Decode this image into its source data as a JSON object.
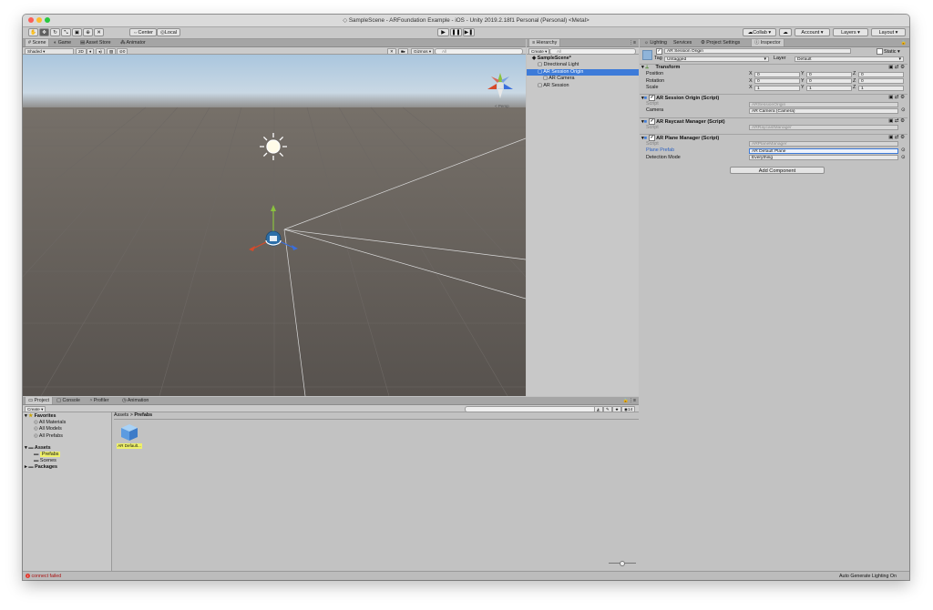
{
  "window": {
    "title": "SampleScene - ARFoundation Example - iOS - Unity 2019.2.18f1 Personal (Personal) <Metal>"
  },
  "toolbar": {
    "pivot_label": "Center",
    "space_label": "Local",
    "collab_label": "Collab",
    "account_label": "Account",
    "layers_label": "Layers",
    "layout_label": "Layout",
    "play_glyph": "▶",
    "pause_glyph": "❚❚",
    "step_glyph": "▶❚"
  },
  "scene_tabs": [
    "Scene",
    "Game",
    "Asset Store",
    "Animator"
  ],
  "scene_toolbar": {
    "shading": "Shaded",
    "mode_2d": "2D",
    "gizmos": "Gizmos",
    "search_placeholder": "All",
    "fx_count": "0"
  },
  "hierarchy": {
    "tab": "Hierarchy",
    "create": "Create",
    "search_placeholder": "All",
    "items": [
      {
        "label": "SampleScene*",
        "depth": 0,
        "selected": false,
        "bold": true
      },
      {
        "label": "Directional Light",
        "depth": 1,
        "selected": false,
        "bold": false
      },
      {
        "label": "AR Session Origin",
        "depth": 1,
        "selected": true,
        "bold": false
      },
      {
        "label": "AR Camera",
        "depth": 2,
        "selected": false,
        "bold": false
      },
      {
        "label": "AR Session",
        "depth": 1,
        "selected": false,
        "bold": false
      }
    ]
  },
  "inspector_tabs": [
    "Lighting",
    "Services",
    "Project Settings",
    "Inspector"
  ],
  "inspector": {
    "object_name": "AR Session Origin",
    "static_label": "Static",
    "tag_label": "Tag",
    "tag_value": "Untagged",
    "layer_label": "Layer",
    "layer_value": "Default",
    "transform": {
      "title": "Transform",
      "rows": [
        {
          "label": "Position",
          "x": "0",
          "y": "0",
          "z": "0"
        },
        {
          "label": "Rotation",
          "x": "0",
          "y": "0",
          "z": "0"
        },
        {
          "label": "Scale",
          "x": "1",
          "y": "1",
          "z": "1"
        }
      ]
    },
    "components": [
      {
        "title": "AR Session Origin (Script)",
        "rows": [
          {
            "label": "Script",
            "value": "ARSessionOrigin",
            "dim": true,
            "highlight": false
          },
          {
            "label": "Camera",
            "value": "AR Camera (Camera)",
            "dim": false,
            "highlight": false
          }
        ]
      },
      {
        "title": "AR Raycast Manager (Script)",
        "rows": [
          {
            "label": "Script",
            "value": "ARRaycastManager",
            "dim": true,
            "highlight": false
          }
        ]
      },
      {
        "title": "AR Plane Manager (Script)",
        "rows": [
          {
            "label": "Script",
            "value": "ARPlaneManager",
            "dim": true,
            "highlight": false
          },
          {
            "label": "Plane Prefab",
            "value": "AR Default Plane",
            "dim": false,
            "highlight": true
          },
          {
            "label": "Detection Mode",
            "value": "Everything",
            "dim": false,
            "highlight": false
          }
        ]
      }
    ],
    "add_component": "Add Component"
  },
  "bottom_tabs": [
    "Project",
    "Console",
    "Profiler",
    "Animation"
  ],
  "project": {
    "create": "Create",
    "search_placeholder": "",
    "breadcrumb_root": "Assets",
    "breadcrumb_sep": ">",
    "breadcrumb_current": "Prefabs",
    "hidden_count": "14",
    "tree": [
      {
        "label": "Favorites",
        "depth": 0,
        "bold": true,
        "selected": false
      },
      {
        "label": "All Materials",
        "depth": 1,
        "bold": false,
        "selected": false
      },
      {
        "label": "All Models",
        "depth": 1,
        "bold": false,
        "selected": false
      },
      {
        "label": "All Prefabs",
        "depth": 1,
        "bold": false,
        "selected": false
      },
      {
        "label": "Assets",
        "depth": 0,
        "bold": true,
        "selected": false
      },
      {
        "label": "Prefabs",
        "depth": 1,
        "bold": false,
        "selected": true
      },
      {
        "label": "Scenes",
        "depth": 1,
        "bold": false,
        "selected": false
      },
      {
        "label": "Packages",
        "depth": 0,
        "bold": true,
        "selected": false
      }
    ],
    "asset_label": "AR Default..."
  },
  "status": {
    "left": "connect failed",
    "right": "Auto Generate Lighting On"
  },
  "colors": {
    "selection": "#3d7bd9",
    "highlight": "#eef06a",
    "sky": "#bcd3e6",
    "ground": "#5e5955",
    "error": "#e23b30"
  }
}
